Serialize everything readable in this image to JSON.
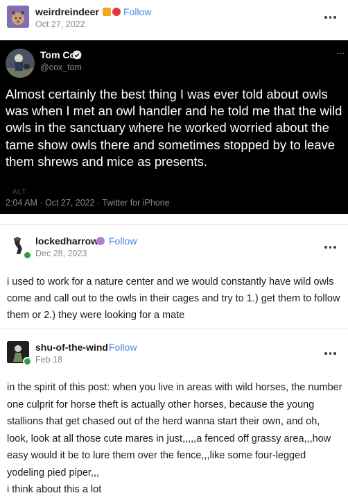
{
  "post1": {
    "username": "weirdreindeer",
    "follow_label": "Follow",
    "date": "Oct 27, 2022"
  },
  "tweet": {
    "name": "Tom Cox",
    "handle": "@cox_tom",
    "text": "Almost certainly the best thing I was ever told about owls was when I met an owl handler and he told me that the wild owls in the sanctuary where he worked worried about the tame show owls there and sometimes stopped by to leave them shrews and mice as presents.",
    "alt_label": "ALT",
    "meta": "2:04 AM · Oct 27, 2022 · Twitter for iPhone"
  },
  "reply1": {
    "username": "lockedharrow",
    "follow_label": "Follow",
    "date": "Dec 28, 2023",
    "text": "i used to work for a nature center and we would constantly have wild owls come and call out to the owls in their cages and try to 1.) get them to follow them or 2.) they were looking for a mate"
  },
  "reply2": {
    "username": "shu-of-the-wind",
    "follow_label": "Follow",
    "date": "Feb 18",
    "text": "in the spirit of this post: when you live in areas with wild horses, the number one culprit for horse theft is actually other horses, because the young stallions that get chased out of the herd wanna start their own, and oh, look, look at all those cute mares in just,,,,,a fenced off grassy area,,,how easy would it be to lure them over the fence,,,like some four-legged yodeling pied piper,,,",
    "text2": "i think about this a lot"
  },
  "colors": {
    "accent": "#4a86e0",
    "online": "#2e9e3e",
    "tweet_bg": "#000000"
  }
}
